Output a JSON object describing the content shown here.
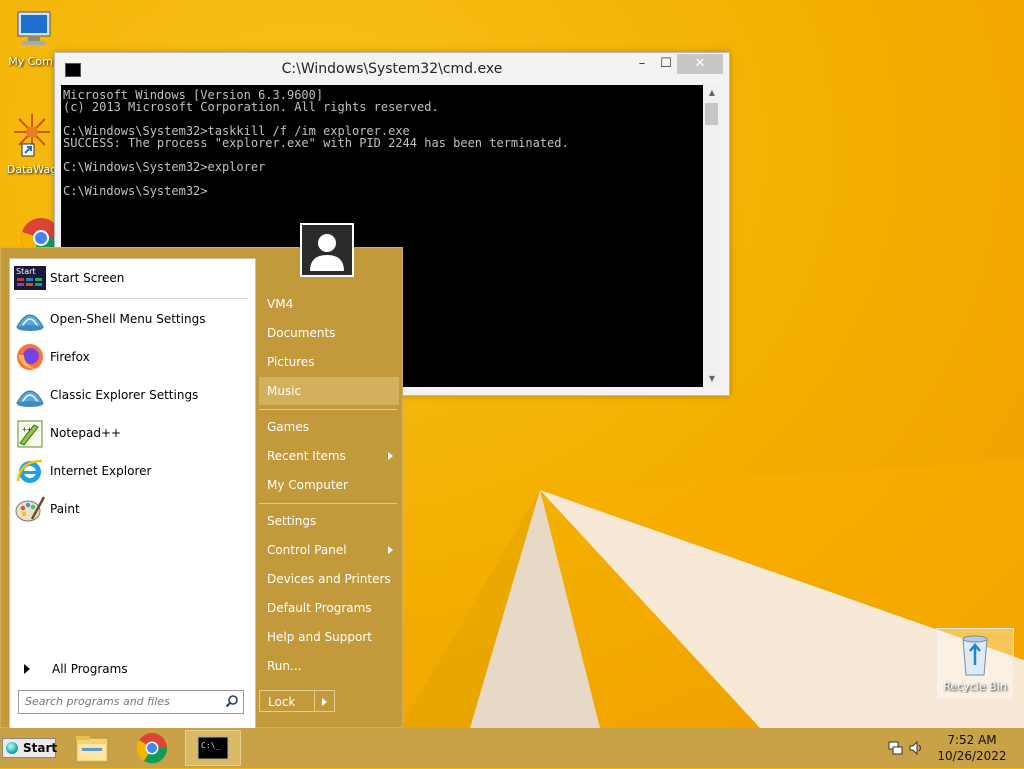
{
  "desktop": {
    "icons": [
      {
        "label": "My Comp"
      },
      {
        "label": "DataWag"
      },
      {
        "label": "Recycle Bin"
      }
    ]
  },
  "cmd": {
    "title": "C:\\Windows\\System32\\cmd.exe",
    "minimize": "–",
    "maximize": "☐",
    "close": "✕",
    "lines": "Microsoft Windows [Version 6.3.9600]\n(c) 2013 Microsoft Corporation. All rights reserved.\n\nC:\\Windows\\System32>taskkill /f /im explorer.exe\nSUCCESS: The process \"explorer.exe\" with PID 2244 has been terminated.\n\nC:\\Windows\\System32>explorer\n\nC:\\Windows\\System32>"
  },
  "start_menu": {
    "left_items": [
      {
        "label": "Start Screen",
        "icon": "start-screen-icon"
      },
      {
        "label": "Open-Shell Menu Settings",
        "icon": "shell-icon"
      },
      {
        "label": "Firefox",
        "icon": "firefox-icon"
      },
      {
        "label": "Classic Explorer Settings",
        "icon": "shell-icon"
      },
      {
        "label": "Notepad++",
        "icon": "notepad-plus-plus-icon"
      },
      {
        "label": "Internet Explorer",
        "icon": "internet-explorer-icon"
      },
      {
        "label": "Paint",
        "icon": "paint-icon"
      }
    ],
    "start_icon_text": "Start",
    "all_programs": "All Programs",
    "search_placeholder": "Search programs and files",
    "right_items": [
      {
        "label": "VM4"
      },
      {
        "label": "Documents"
      },
      {
        "label": "Pictures"
      },
      {
        "label": "Music"
      },
      {
        "label": "Games"
      },
      {
        "label": "Recent Items"
      },
      {
        "label": "My Computer"
      },
      {
        "label": "Settings"
      },
      {
        "label": "Control Panel"
      },
      {
        "label": "Devices and Printers"
      },
      {
        "label": "Default Programs"
      },
      {
        "label": "Help and Support"
      },
      {
        "label": "Run..."
      }
    ],
    "lock": "Lock"
  },
  "taskbar": {
    "start": "Start",
    "time": "7:52 AM",
    "date": "10/26/2022",
    "cmd_icon_text": "C:\\_"
  }
}
